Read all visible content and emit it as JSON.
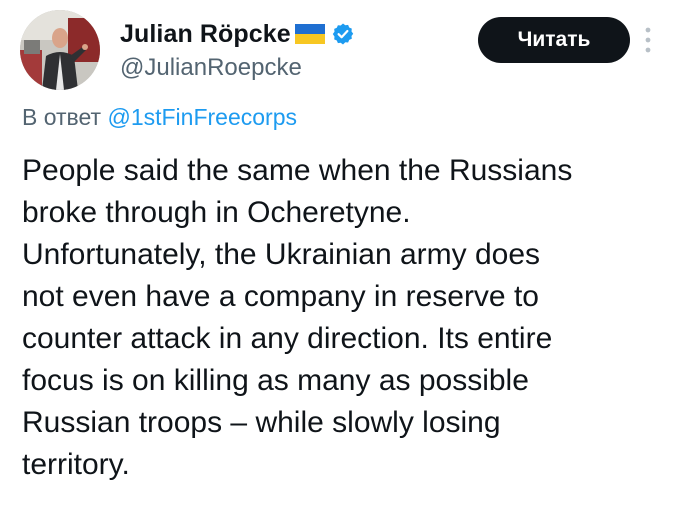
{
  "author": {
    "name": "Julian Röpcke",
    "handle": "@JulianRoepcke",
    "flag_icon": "ukraine-flag-icon",
    "verified_icon": "verified-badge-icon",
    "verified_color": "#1d9bf0"
  },
  "actions": {
    "follow_label": "Читать",
    "more_icon": "more-vertical-icon"
  },
  "reply": {
    "prefix": "В ответ",
    "target": "@1stFinFreecorps"
  },
  "tweet": {
    "lines": [
      "People said the same when the Russians",
      "broke through in Ocheretyne.",
      "Unfortunately, the Ukrainian army does",
      "not even have a company in reserve to",
      "counter attack in any direction. Its entire",
      "focus is on killing as many as possible",
      "Russian troops – while slowly losing",
      "territory."
    ]
  },
  "colors": {
    "text": "#0f1419",
    "secondary": "#536471",
    "link": "#1d9bf0",
    "button_bg": "#0f1419",
    "button_text": "#ffffff"
  }
}
